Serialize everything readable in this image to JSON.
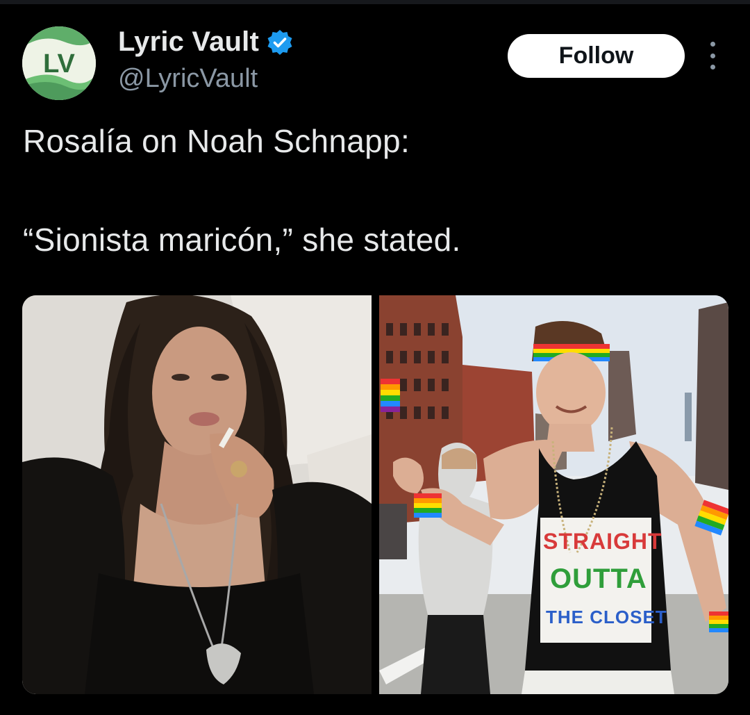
{
  "author": {
    "display_name": "Lyric Vault",
    "handle": "@LyricVault",
    "avatar_initials": "LV",
    "verified": true
  },
  "actions": {
    "follow_label": "Follow"
  },
  "tweet": {
    "line1": "Rosalía on Noah Schnapp:",
    "line2": "“Sionista maricón,” she stated."
  },
  "media": {
    "right_shirt_lines": [
      "STRAIGHT",
      "OUTTA",
      "THE CLOSET"
    ]
  },
  "colors": {
    "background": "#000000",
    "text": "#e7e9ea",
    "secondary_text": "#8b98a5",
    "verified_blue": "#1d9bf0",
    "follow_bg": "#ffffff"
  },
  "icons": {
    "verified": "verified-badge-icon",
    "more": "more-options-icon"
  }
}
